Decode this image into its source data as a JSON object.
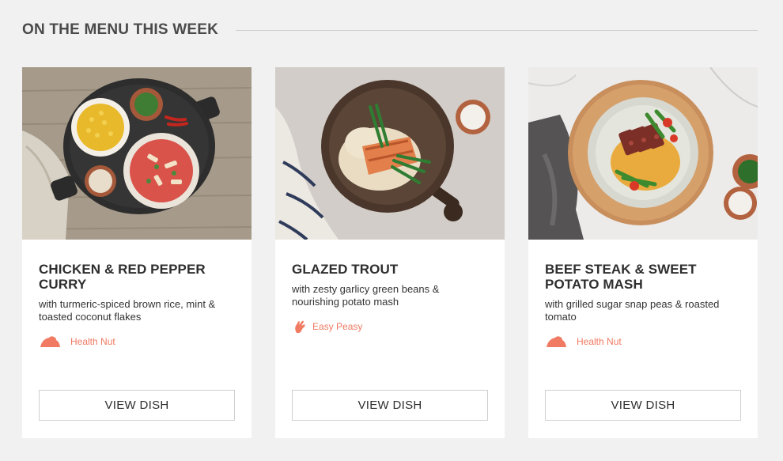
{
  "section": {
    "title": "ON THE MENU THIS WEEK"
  },
  "dishes": [
    {
      "title": "CHICKEN & RED PEPPER CURRY",
      "description": "with turmeric-spiced brown rice, mint & toasted coconut flakes",
      "tag": {
        "label": "Health Nut",
        "icon": "health-nut-icon"
      },
      "button": "VIEW DISH"
    },
    {
      "title": "GLAZED TROUT",
      "description": "with zesty garlicy green beans & nourishing potato mash",
      "tag": {
        "label": "Easy Peasy",
        "icon": "easy-peasy-icon"
      },
      "button": "VIEW DISH"
    },
    {
      "title": "BEEF STEAK & SWEET POTATO MASH",
      "description": "with grilled sugar snap peas & roasted tomato",
      "tag": {
        "label": "Health Nut",
        "icon": "health-nut-icon"
      },
      "button": "VIEW DISH"
    }
  ],
  "colors": {
    "background": "#f0f1f0",
    "tag_accent": "#f07a62",
    "card": "#ffffff"
  }
}
